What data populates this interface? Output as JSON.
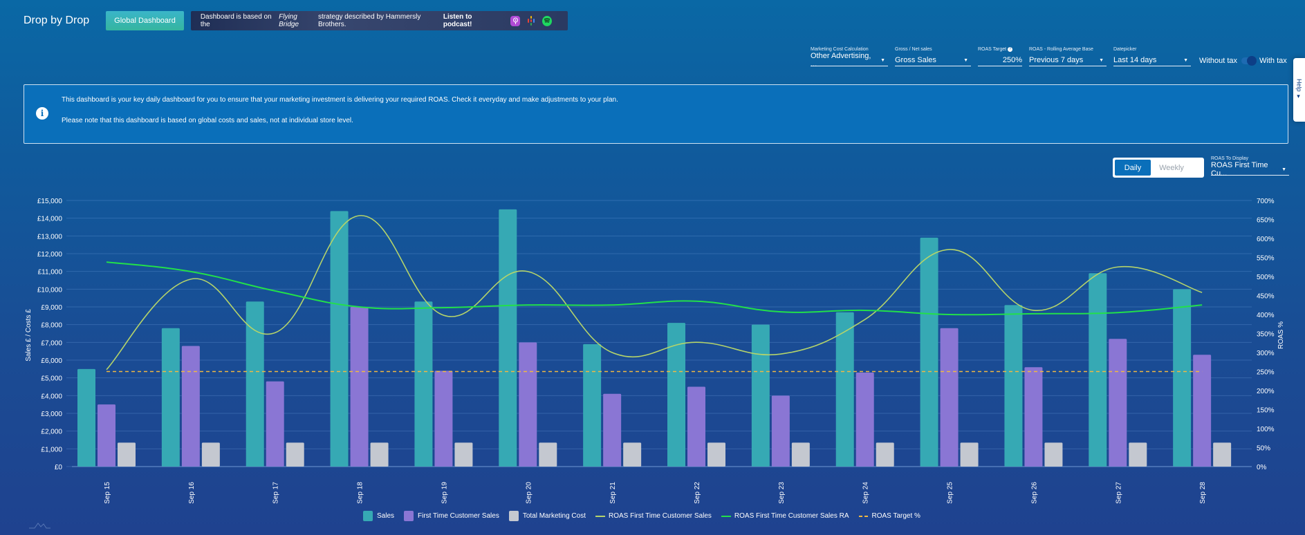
{
  "header": {
    "brand": "Drop by Drop",
    "global_dashboard_button": "Global Dashboard",
    "banner": {
      "text_before": "Dashboard is based on the",
      "text_italic": "Flying Bridge",
      "text_after": "strategy described by Hammersly Brothers.",
      "listen_label": "Listen to podcast!",
      "icons": [
        "apple-podcasts-icon",
        "google-podcasts-icon",
        "spotify-icon"
      ]
    }
  },
  "filters": {
    "marketing_cost": {
      "label": "Marketing Cost Calculation",
      "value": "Other Advertising, ..."
    },
    "gross_net": {
      "label": "Gross / Net sales",
      "value": "Gross Sales"
    },
    "roas_target": {
      "label": "ROAS Target",
      "value": "250%"
    },
    "rolling_base": {
      "label": "ROAS - Rolling Average Base",
      "value": "Previous 7 days"
    },
    "datepicker": {
      "label": "Datepicker",
      "value": "Last 14 days"
    },
    "tax": {
      "without_label": "Without tax",
      "with_label": "With tax",
      "selected": "With tax"
    }
  },
  "help_tab": {
    "label": "Help"
  },
  "info": {
    "line1": "This dashboard is your key daily dashboard for you to ensure that your marketing investment is delivering your required ROAS. Check it everyday and make adjustments to your plan.",
    "line2": "Please note that this dashboard is based on global costs and sales, not at individual store level."
  },
  "period_toggle": {
    "options": [
      "Daily",
      "Weekly"
    ],
    "selected": "Daily"
  },
  "roas_to_display": {
    "label": "ROAS To Display",
    "value": "ROAS First Time Cu..."
  },
  "colors": {
    "sales": "#36a9b4",
    "first_time": "#8a76d4",
    "marketing_cost": "#c4c8d0",
    "roas_ftc": "#b5d46a",
    "roas_ftc_ra": "#22e04a",
    "roas_target": "#f0b842"
  },
  "chart_data": {
    "type": "bar",
    "categories": [
      "Sep 15",
      "Sep 16",
      "Sep 17",
      "Sep 18",
      "Sep 19",
      "Sep 20",
      "Sep 21",
      "Sep 22",
      "Sep 23",
      "Sep 24",
      "Sep 25",
      "Sep 26",
      "Sep 27",
      "Sep 28"
    ],
    "ylabel": "Sales £ / Costs £",
    "y2label": "ROAS %",
    "ylim": [
      0,
      15000
    ],
    "y2lim": [
      0,
      700
    ],
    "yticks": [
      "£0",
      "£1,000",
      "£2,000",
      "£3,000",
      "£4,000",
      "£5,000",
      "£6,000",
      "£7,000",
      "£8,000",
      "£9,000",
      "£10,000",
      "£11,000",
      "£12,000",
      "£13,000",
      "£14,000",
      "£15,000"
    ],
    "y2ticks": [
      "0%",
      "50%",
      "100%",
      "150%",
      "200%",
      "250%",
      "300%",
      "350%",
      "400%",
      "450%",
      "500%",
      "550%",
      "600%",
      "650%",
      "700%"
    ],
    "grid": true,
    "legend_position": "bottom",
    "bar_series": [
      {
        "name": "Sales",
        "values": [
          5500,
          7800,
          9300,
          14400,
          9300,
          14500,
          6900,
          8100,
          8000,
          8700,
          12900,
          9100,
          10900,
          10000
        ]
      },
      {
        "name": "First Time Customer Sales",
        "values": [
          3500,
          6800,
          4800,
          9000,
          5400,
          7000,
          4100,
          4500,
          4000,
          5300,
          7800,
          5600,
          7200,
          6300
        ]
      },
      {
        "name": "Total Marketing Cost",
        "values": [
          1350,
          1350,
          1350,
          1350,
          1350,
          1350,
          1350,
          1350,
          1350,
          1350,
          1350,
          1350,
          1350,
          1350
        ]
      }
    ],
    "line_series": [
      {
        "name": "ROAS First Time Customer Sales",
        "axis": "right",
        "values": [
          255,
          493,
          352,
          660,
          398,
          513,
          300,
          327,
          296,
          387,
          571,
          411,
          525,
          458
        ]
      },
      {
        "name": "ROAS First Time Customer Sales RA",
        "axis": "right",
        "values": [
          538,
          513,
          462,
          420,
          418,
          425,
          425,
          435,
          407,
          411,
          400,
          402,
          405,
          425
        ]
      },
      {
        "name": "ROAS Target %",
        "axis": "right",
        "dashed": true,
        "values": [
          250,
          250,
          250,
          250,
          250,
          250,
          250,
          250,
          250,
          250,
          250,
          250,
          250,
          250
        ]
      }
    ]
  }
}
